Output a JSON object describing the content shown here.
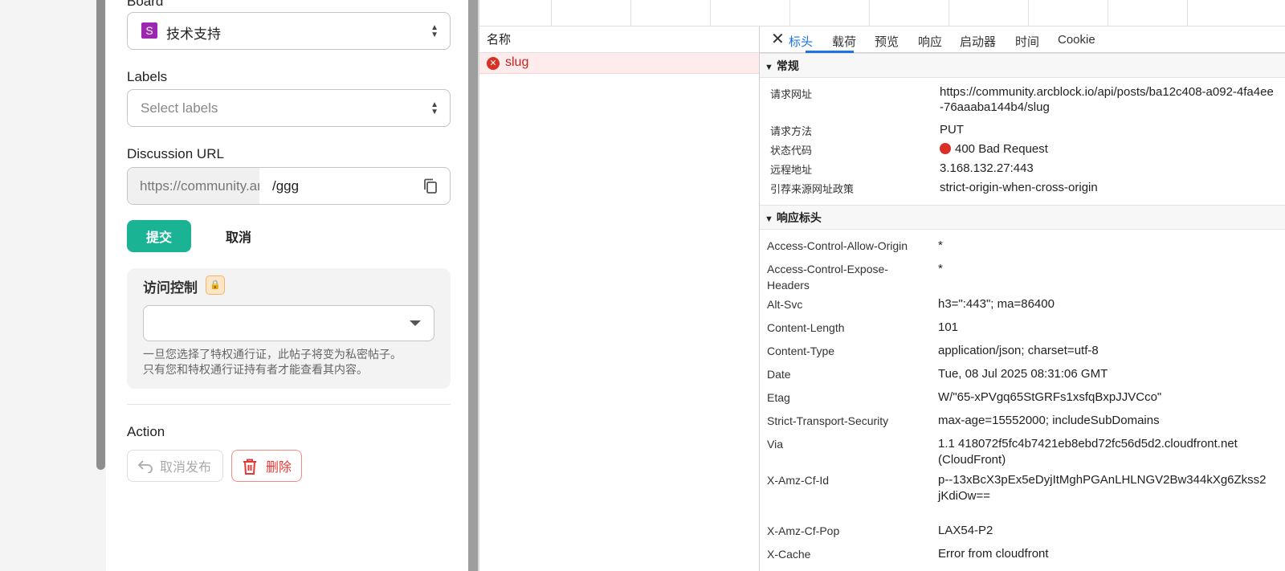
{
  "form": {
    "board_label": "Board",
    "board_badge": "S",
    "board_value": "技术支持",
    "labels_label": "Labels",
    "labels_placeholder": "Select labels",
    "url_label": "Discussion URL",
    "url_prefix": "https://community.arcblock.io/discussions/",
    "url_slug": "/ggg",
    "submit_label": "提交",
    "cancel_label": "取消",
    "access_title": "访问控制",
    "access_help": "一旦您选择了特权通行证，此帖子将变为私密帖子。\n只有您和特权通行证持有者才能查看其内容。",
    "action_label": "Action",
    "unpublish_label": "取消发布",
    "delete_label": "删除"
  },
  "network": {
    "name_header": "名称",
    "request_name": "slug",
    "status_color": "#d93025"
  },
  "detail": {
    "tabs": [
      "标头",
      "载荷",
      "预览",
      "响应",
      "启动器",
      "时间",
      "Cookie"
    ],
    "active_tab": "标头",
    "general_title": "常规",
    "general": [
      {
        "key": "请求网址",
        "value": "https://community.arcblock.io/api/posts/ba12c408-a092-4fa4ee-76aaaba144b4/slug"
      },
      {
        "key": "请求方法",
        "value": "PUT"
      },
      {
        "key": "状态代码",
        "value": "400 Bad Request"
      },
      {
        "key": "远程地址",
        "value": "3.168.132.27:443"
      },
      {
        "key": "引荐来源网址政策",
        "value": "strict-origin-when-cross-origin"
      }
    ],
    "response_title": "响应标头",
    "response_headers": [
      {
        "key": "Access-Control-Allow-Origin",
        "value": "*"
      },
      {
        "key": "Access-Control-Expose-Headers",
        "value": "*"
      },
      {
        "key": "Alt-Svc",
        "value": "h3=\":443\"; ma=86400"
      },
      {
        "key": "Content-Length",
        "value": "101"
      },
      {
        "key": "Content-Type",
        "value": "application/json; charset=utf-8"
      },
      {
        "key": "Date",
        "value": "Tue, 08 Jul 2025 08:31:06 GMT"
      },
      {
        "key": "Etag",
        "value": "W/\"65-xPVgq65StGRFs1xsfqBxpJJVCco\""
      },
      {
        "key": "Strict-Transport-Security",
        "value": "max-age=15552000; includeSubDomains"
      },
      {
        "key": "Via",
        "value": "1.1 418072f5fc4b7421eb8ebd72fc56d5d2.cloudfront.net (CloudFront)"
      },
      {
        "key": "X-Amz-Cf-Id",
        "value": "p--13xBcX3pEx5eDyjItMghPGAnLHLNGV2Bw344kXg6Zkss2jKdiOw=="
      },
      {
        "key": "X-Amz-Cf-Pop",
        "value": "LAX54-P2"
      },
      {
        "key": "X-Cache",
        "value": "Error from cloudfront"
      }
    ]
  }
}
